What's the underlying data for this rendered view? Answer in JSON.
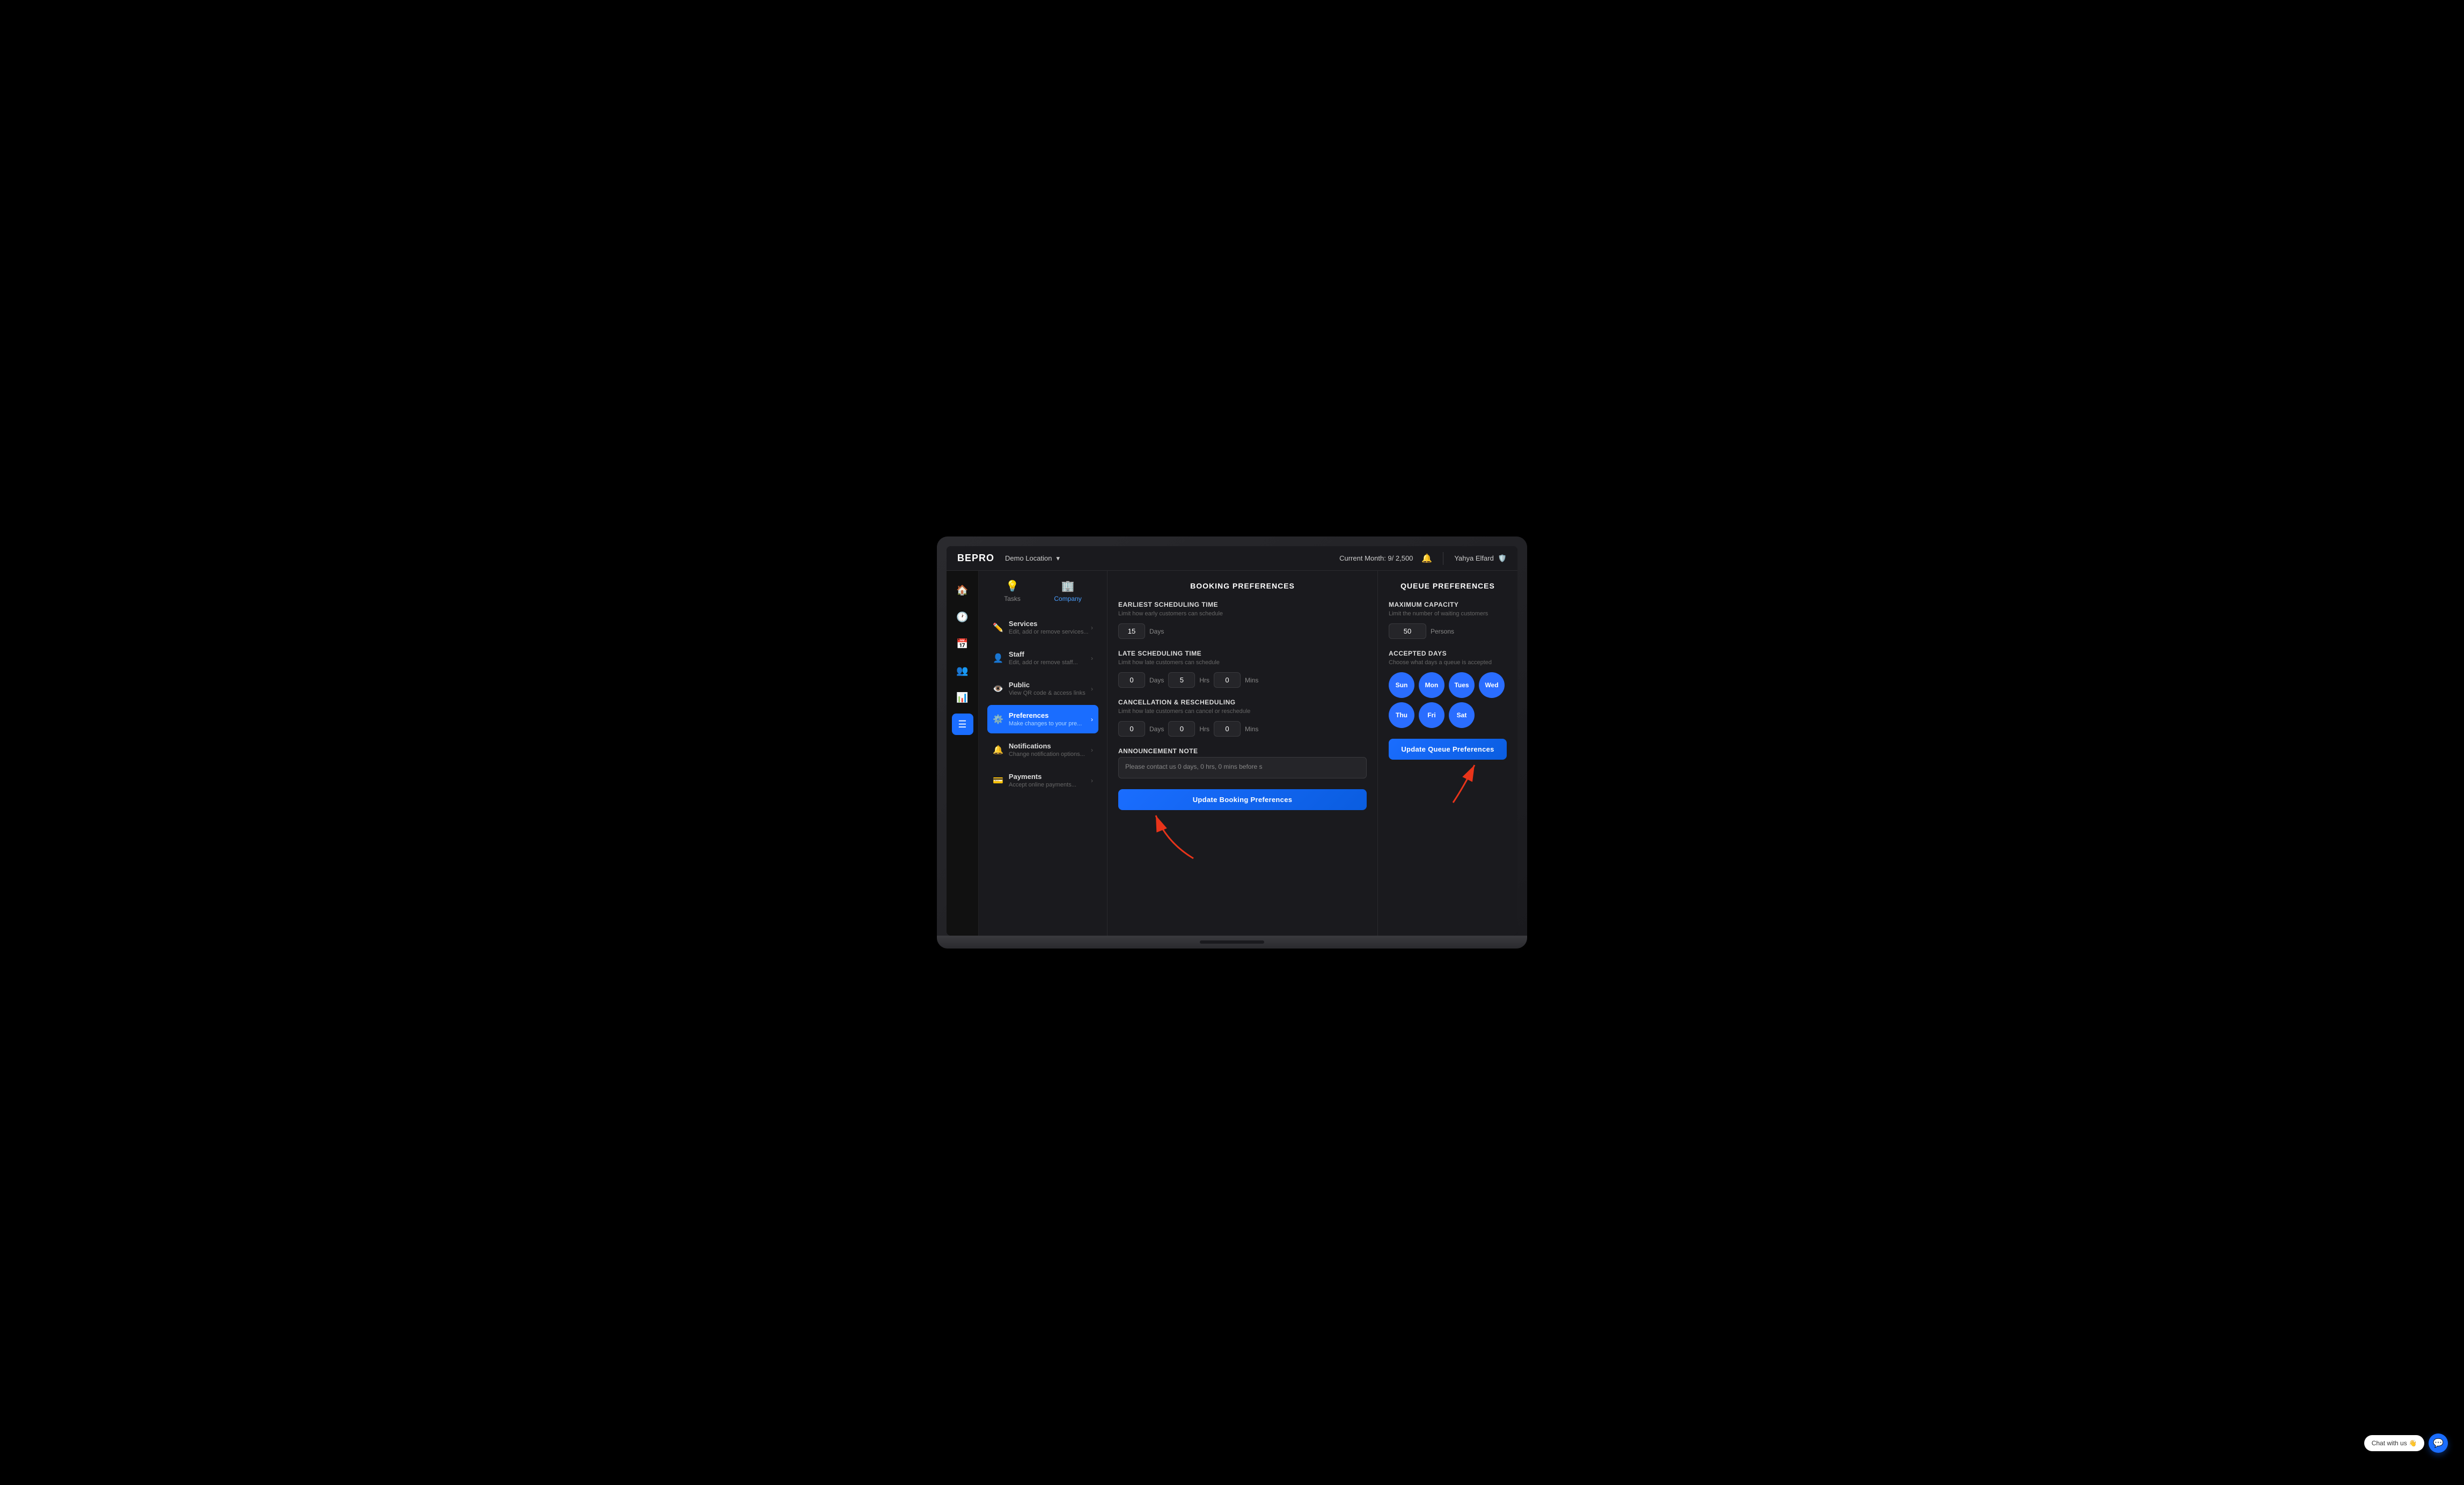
{
  "topbar": {
    "logo": "BEPRO",
    "location": "Demo Location",
    "current_month_label": "Current Month: 9/ 2,500",
    "user_name": "Yahya Elfard"
  },
  "sidebar": {
    "items": [
      {
        "name": "home",
        "icon": "🏠",
        "active": false
      },
      {
        "name": "clock",
        "icon": "🕐",
        "active": false
      },
      {
        "name": "calendar",
        "icon": "📅",
        "active": false
      },
      {
        "name": "users",
        "icon": "👥",
        "active": false
      },
      {
        "name": "chart",
        "icon": "📊",
        "active": false
      },
      {
        "name": "list",
        "icon": "☰",
        "active": true
      }
    ]
  },
  "left_panel": {
    "tabs": [
      {
        "label": "Tasks",
        "icon": "💡",
        "active": false
      },
      {
        "label": "Company",
        "icon": "🏢",
        "active": true
      }
    ],
    "menu_items": [
      {
        "id": "services",
        "icon": "✏️",
        "title": "Services",
        "subtitle": "Edit, add or remove services...",
        "active": false
      },
      {
        "id": "staff",
        "icon": "👤",
        "title": "Staff",
        "subtitle": "Edit, add or remove staff...",
        "active": false
      },
      {
        "id": "public",
        "icon": "👁️",
        "title": "Public",
        "subtitle": "View QR code & access links",
        "active": false
      },
      {
        "id": "preferences",
        "icon": "⚙️",
        "title": "Preferences",
        "subtitle": "Make changes to your pre...",
        "active": true
      },
      {
        "id": "notifications",
        "icon": "🔔",
        "title": "Notifications",
        "subtitle": "Change notification options...",
        "active": false
      },
      {
        "id": "payments",
        "icon": "💳",
        "title": "Payments",
        "subtitle": "Accept online payments...",
        "active": false
      }
    ]
  },
  "booking_preferences": {
    "title": "BOOKING PREFERENCES",
    "earliest_scheduling": {
      "title": "EARLIEST SCHEDULING TIME",
      "subtitle": "Limit how early customers can schedule",
      "days_value": "15",
      "days_label": "Days"
    },
    "late_scheduling": {
      "title": "LATE SCHEDULING TIME",
      "subtitle": "Limit how late customers can schedule",
      "days_value": "0",
      "days_label": "Days",
      "hrs_value": "5",
      "hrs_label": "Hrs",
      "mins_value": "0",
      "mins_label": "Mins"
    },
    "cancellation": {
      "title": "CANCELLATION & RESCHEDULING",
      "subtitle": "Limit how late customers can cancel or reschedule",
      "days_value": "0",
      "days_label": "Days",
      "hrs_value": "0",
      "hrs_label": "Hrs",
      "mins_value": "0",
      "mins_label": "Mins"
    },
    "announcement": {
      "title": "ANNOUNCEMENT NOTE",
      "text": "Please contact us 0 days, 0 hrs, 0 mins before s"
    },
    "update_btn": "Update Booking Preferences"
  },
  "queue_preferences": {
    "title": "QUEUE PREFERENCES",
    "max_capacity": {
      "title": "MAXIMUM CAPACITY",
      "subtitle": "Limit the number of waiting customers",
      "value": "50",
      "label": "Persons"
    },
    "accepted_days": {
      "title": "ACCEPTED DAYS",
      "subtitle": "Choose what days a queue is accepted",
      "days": [
        {
          "label": "Sun",
          "active": true
        },
        {
          "label": "Mon",
          "active": true
        },
        {
          "label": "Tues",
          "active": true
        },
        {
          "label": "Wed",
          "active": true
        },
        {
          "label": "Thu",
          "active": true
        },
        {
          "label": "Fri",
          "active": true
        },
        {
          "label": "Sat",
          "active": true
        }
      ]
    },
    "update_btn": "Update Queue Preferences"
  },
  "chat_widget": {
    "label": "Chat with us 👋",
    "icon": "💬"
  }
}
